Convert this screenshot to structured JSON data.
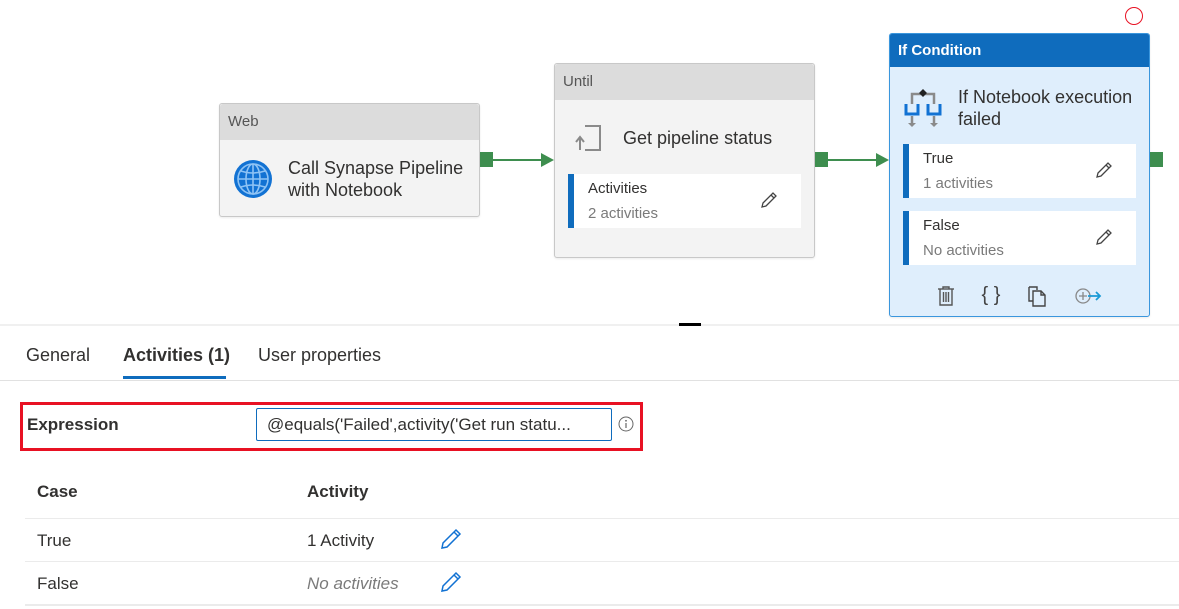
{
  "canvas": {
    "web_node": {
      "type_label": "Web",
      "title_line1": "Call Synapse Pipeline",
      "title_line2": "with Notebook",
      "icon": "globe-icon"
    },
    "until_node": {
      "type_label": "Until",
      "title": "Get pipeline status",
      "icon": "until-loop-icon",
      "activities": {
        "title": "Activities",
        "subtitle": "2 activities"
      }
    },
    "if_node": {
      "type_label": "If Condition",
      "title_line1": "If Notebook execution",
      "title_line2": "failed",
      "icon": "if-condition-icon",
      "true_branch": {
        "title": "True",
        "subtitle": "1 activities"
      },
      "false_branch": {
        "title": "False",
        "subtitle": "No activities"
      },
      "toolbar": [
        "delete-icon",
        "code-braces-icon",
        "copy-icon",
        "add-output-icon"
      ]
    },
    "colors": {
      "accent": "#0f6cbd",
      "connector": "#3e8e4f",
      "highlight": "#e81123",
      "selected_bg": "#dfeefc"
    }
  },
  "tabs": [
    {
      "label": "General",
      "active": false
    },
    {
      "label": "Activities (1)",
      "active": true
    },
    {
      "label": "User properties",
      "active": false
    }
  ],
  "expression": {
    "label": "Expression",
    "value": "@equals('Failed',activity('Get run statu..."
  },
  "cases_table": {
    "headers": [
      "Case",
      "Activity"
    ],
    "rows": [
      {
        "case": "True",
        "activity": "1 Activity",
        "muted": false
      },
      {
        "case": "False",
        "activity": "No activities",
        "muted": true
      }
    ]
  }
}
